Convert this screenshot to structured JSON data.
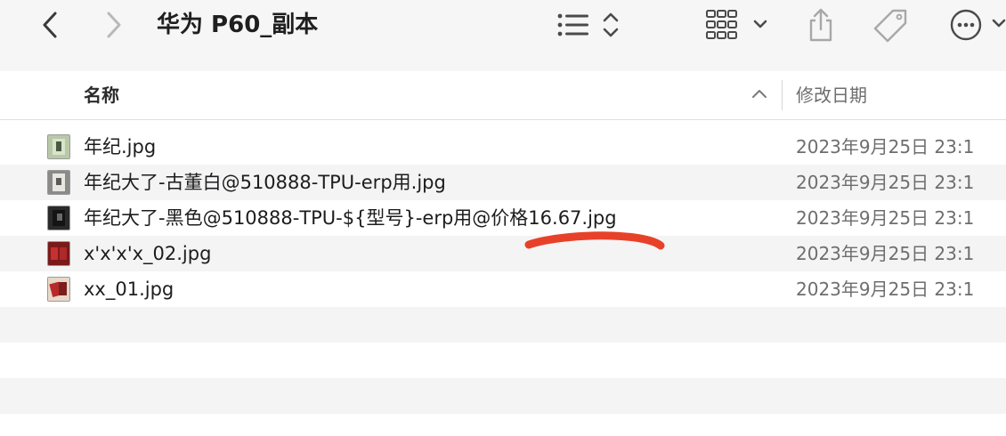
{
  "window": {
    "title": "华为 P60_副本"
  },
  "toolbar": {
    "back_icon": "chevron-left-icon",
    "forward_icon": "chevron-right-icon",
    "view_icon": "list-view-icon",
    "group_icon": "grid-view-icon",
    "share_icon": "share-icon",
    "tag_icon": "tag-icon",
    "more_icon": "ellipsis-circle-icon"
  },
  "columns": {
    "name": "名称",
    "date_modified": "修改日期"
  },
  "files": [
    {
      "name": "年纪.jpg",
      "date": "2023年9月25日 23:1"
    },
    {
      "name": "年纪大了-古董白@510888-TPU-erp用.jpg",
      "date": "2023年9月25日 23:1"
    },
    {
      "name": "年纪大了-黑色@510888-TPU-${型号}-erp用@价格16.67.jpg",
      "date": "2023年9月25日 23:1"
    },
    {
      "name": "x'x'x'x_02.jpg",
      "date": "2023年9月25日 23:1"
    },
    {
      "name": "xx_01.jpg",
      "date": "2023年9月25日 23:1"
    }
  ],
  "colors": {
    "toolbar_bg": "#f6f6f6",
    "stripe": "#f4f4f4",
    "annotation": "#e8412a"
  }
}
